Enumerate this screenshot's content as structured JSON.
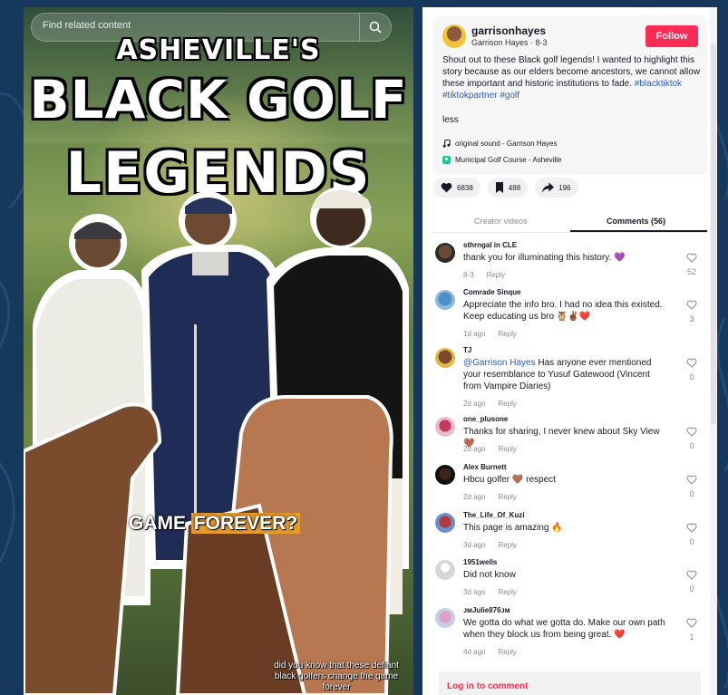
{
  "search": {
    "placeholder": "Find related content"
  },
  "video": {
    "title_line1": "ASHEVILLE'S",
    "title_line2": "BLACK GOLF",
    "title_line3": "LEGENDS",
    "caption_game": "GAME",
    "caption_forever": "FOREVER?",
    "caption_bottom": "did you know that these defiant black golfers change the game forever"
  },
  "author": {
    "username": "garrisonhayes",
    "subline": "Garrison Hayes · 8-3",
    "follow_label": "Follow"
  },
  "description": {
    "text": "Shout out to these Black golf legends! I wanted to highlight this story because as our elders become ancestors, we cannot allow these important and historic institutions to fade.",
    "tag1": "#blacktiktok",
    "tag2": "#tiktokpartner",
    "tag3": "#golf",
    "less_label": "less",
    "sound": "original sound - Garrison Hayes",
    "location": "Municipal Golf Course - Asheville"
  },
  "actions": {
    "likes": "6838",
    "saves": "488",
    "shares": "196"
  },
  "tabs": {
    "creator_videos": "Creator videos",
    "comments": "Comments (56)"
  },
  "comments": [
    {
      "user": "sthrngal in CLE",
      "text": "thank you for illuminating this history. 💜",
      "date": "8-3",
      "reply": "Reply",
      "likes": "52"
    },
    {
      "user": "Comrade Sinque",
      "text": "Appreciate the info bro. I had no idea this existed. Keep educating us bro 🦉✌🏾❤️",
      "date": "1d ago",
      "reply": "Reply",
      "likes": "3"
    },
    {
      "user": "TJ",
      "mention": "@Garrison Hayes",
      "text": " Has anyone ever mentioned your resemblance to Yusuf Gatewood (Vincent from Vampire Diaries)",
      "date": "2d ago",
      "reply": "Reply",
      "likes": "0"
    },
    {
      "user": "one_plusone",
      "text": "Thanks for sharing, I never knew about Sky View 🤎",
      "date": "2d ago",
      "reply": "Reply",
      "likes": "0"
    },
    {
      "user": "Alex Burnett",
      "text": "Hbcu golfer 🤎 respect",
      "date": "2d ago",
      "reply": "Reply",
      "likes": "0"
    },
    {
      "user": "The_Life_Of_Kuzi",
      "text": "This page is amazing 🔥",
      "date": "3d ago",
      "reply": "Reply",
      "likes": "0"
    },
    {
      "user": "1951wells",
      "text": "Did not know",
      "date": "3d ago",
      "reply": "Reply",
      "likes": "0"
    },
    {
      "user": "ᴊᴍJulie876ᴊᴍ",
      "text": "We gotta do what we gotta do. Make our own path when they block us from being great. ❤️",
      "date": "4d ago",
      "reply": "Reply",
      "likes": "1"
    }
  ],
  "login": {
    "label": "Log in to comment"
  }
}
